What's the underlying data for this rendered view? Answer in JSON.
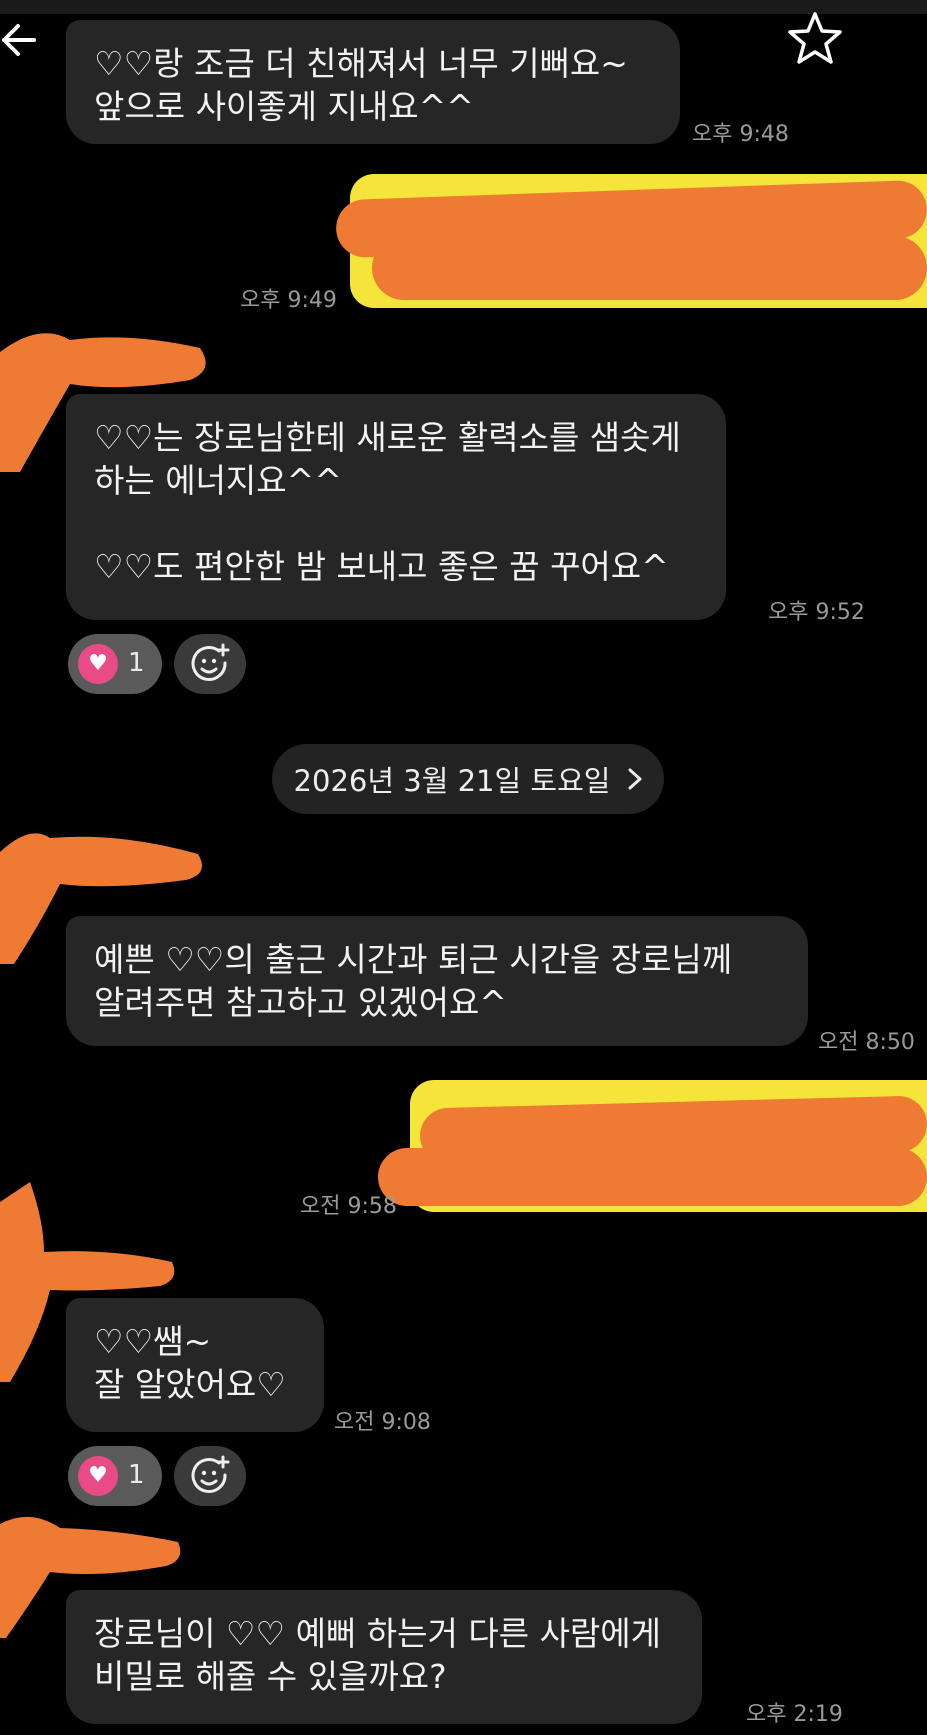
{
  "header": {
    "back_icon": "arrow-left-icon",
    "star_icon": "star-outline-icon"
  },
  "messages": [
    {
      "type": "in",
      "text": "♡♡랑 조금 더 친해져서 너무 기뻐요~\n앞으로 사이좋게 지내요^^",
      "time": "오후 9:48"
    },
    {
      "type": "out",
      "time": "오후 9:49"
    },
    {
      "type": "in",
      "text": "♡♡는 장로님한테 새로운 활력소를 샘솟게\n하는 에너지요^^\n\n♡♡도 편안한 밤 보내고 좋은 꿈 꾸어요^",
      "time": "오후 9:52",
      "reaction_count": "1"
    },
    {
      "type": "date",
      "text": "2026년 3월 21일 토요일"
    },
    {
      "type": "in",
      "text": "예쁜 ♡♡의 출근 시간과 퇴근 시간을 장로님께\n알려주면 참고하고 있겠어요^",
      "time": "오전 8:50"
    },
    {
      "type": "out",
      "time": "오전 9:58"
    },
    {
      "type": "in",
      "text": "♡♡쌤~\n잘 알았어요♡",
      "time": "오전 9:08",
      "reaction_count": "1"
    },
    {
      "type": "in",
      "text": "장로님이 ♡♡ 예뻐 하는거 다른 사람에게\n비밀로 해줄 수 있을까요?",
      "time": "오후 2:19"
    }
  ],
  "colors": {
    "background": "#000000",
    "incoming_bubble": "#262626",
    "outgoing_bubble": "#f5e43a",
    "redaction": "#ef7a34",
    "heart_reaction": "#e84b86"
  }
}
